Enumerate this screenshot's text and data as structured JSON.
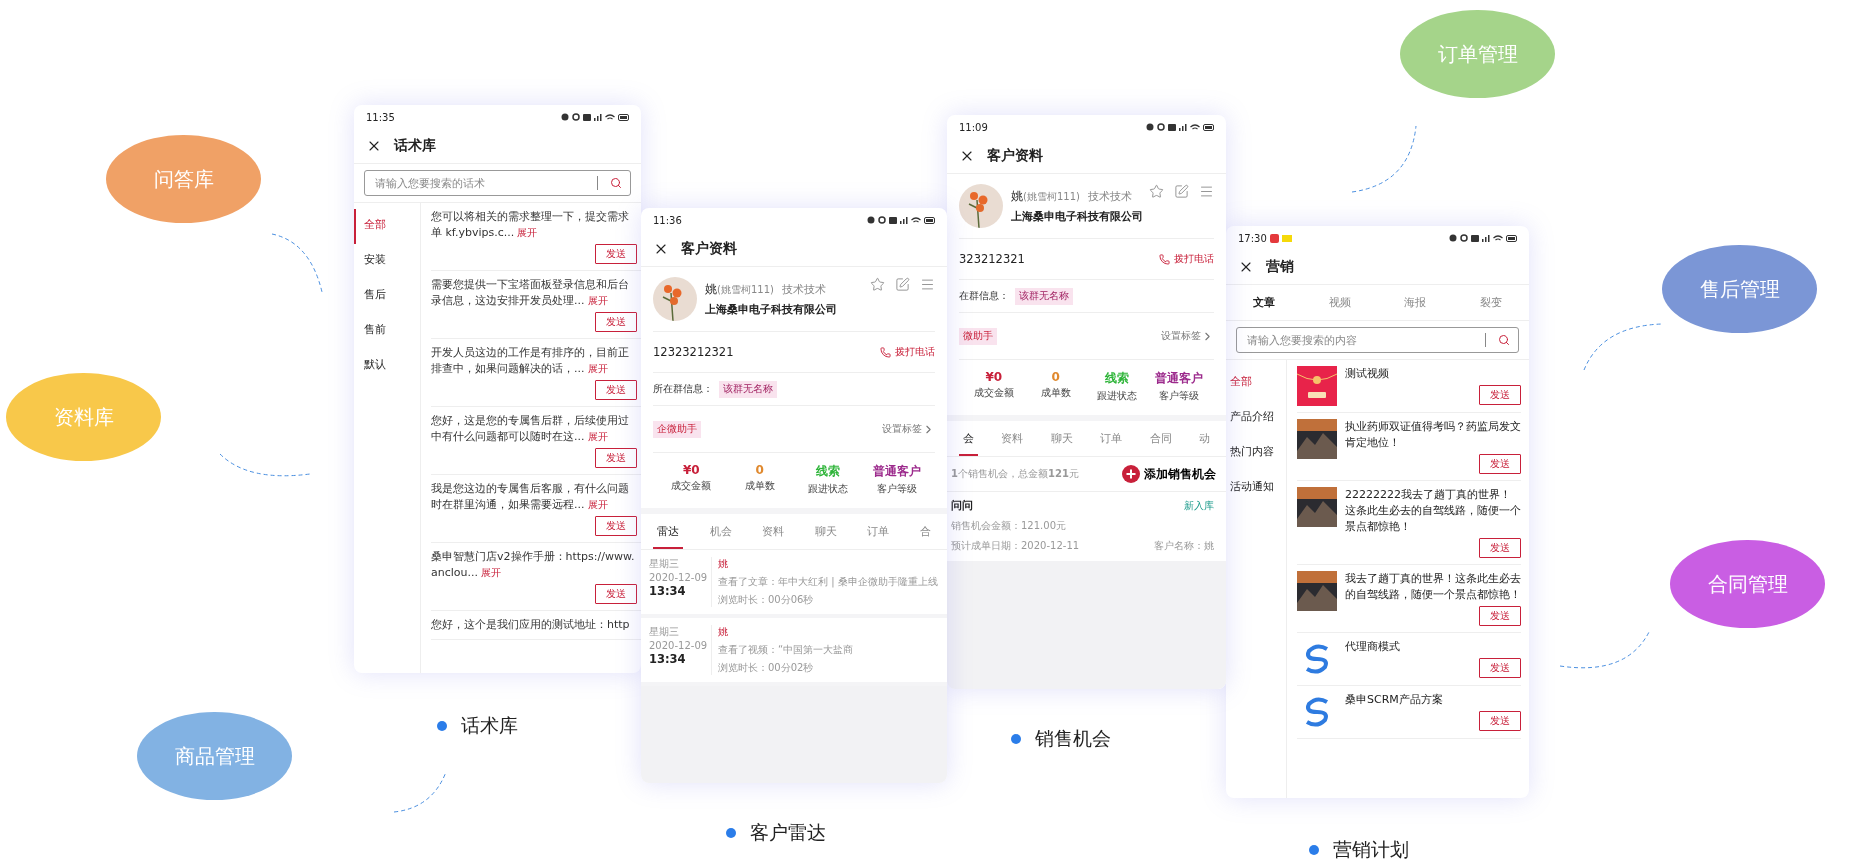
{
  "bubbles": [
    {
      "label": "问答库",
      "color": "#f0a166"
    },
    {
      "label": "资料库",
      "color": "#f8c84a"
    },
    {
      "label": "商品管理",
      "color": "#82b2e3"
    },
    {
      "label": "订单管理",
      "color": "#a5d48a"
    },
    {
      "label": "售后管理",
      "color": "#7b96d6"
    },
    {
      "label": "合同管理",
      "color": "#c95ee3"
    }
  ],
  "phones": [
    {
      "kind": "scripts",
      "time": "11:35",
      "title": "话术库",
      "search_placeholder": "请输入您要搜索的话术",
      "categories": [
        {
          "label": "全部",
          "selected": true
        },
        {
          "label": "安装",
          "selected": false
        },
        {
          "label": "售后",
          "selected": false
        },
        {
          "label": "售前",
          "selected": false
        },
        {
          "label": "默认",
          "selected": false
        }
      ],
      "items": [
        {
          "lines": [
            "您可以将相关的需求整理一下，提交需求",
            "单 kf.ybvips.c..."
          ],
          "expand": "展开",
          "send": "发送"
        },
        {
          "lines": [
            "需要您提供一下宝塔面板登录信息和后台",
            "录信息，这边安排开发员处理..."
          ],
          "expand": "展开",
          "send": "发送"
        },
        {
          "lines": [
            "开发人员这边的工作是有排序的，目前正",
            "排查中，如果问题解决的话，..."
          ],
          "expand": "展开",
          "send": "发送"
        },
        {
          "lines": [
            "您好，这是您的专属售后群，后续使用过",
            "中有什么问题都可以随时在这..."
          ],
          "expand": "展开",
          "send": "发送"
        },
        {
          "lines": [
            "我是您这边的专属售后客服，有什么问题",
            "时在群里沟通，如果需要远程..."
          ],
          "expand": "展开",
          "send": "发送"
        },
        {
          "lines": [
            "桑申智慧门店v2操作手册：https://www.",
            "anclou..."
          ],
          "expand": "展开",
          "send": "发送"
        },
        {
          "lines": [
            "您好，这个是我们应用的测试地址：http"
          ]
        }
      ]
    },
    {
      "kind": "profile",
      "time": "11:36",
      "title": "客户资料",
      "name": "姚",
      "alias": "(姚雪柯111)",
      "position": "技术技术",
      "company": "上海桑申电子科技有限公司",
      "phone": "12323212321",
      "call": "拨打电话",
      "group_label": "所在群信息：",
      "group": "该群无名称",
      "tag": "企微助手",
      "set_tags": "设置标签",
      "stats": [
        {
          "value": "¥0",
          "label": "成交金额",
          "color": "#c8203a"
        },
        {
          "value": "0",
          "label": "成单数",
          "color": "#e0892e"
        },
        {
          "value": "线索",
          "label": "跟进状态",
          "color": "#2fb53a"
        },
        {
          "value": "普通客户",
          "label": "客户等级",
          "color": "#9c2a8c"
        }
      ],
      "tabs": [
        {
          "label": "雷达",
          "selected": true
        },
        {
          "label": "机会",
          "selected": false
        },
        {
          "label": "资料",
          "selected": false
        },
        {
          "label": "聊天",
          "selected": false
        },
        {
          "label": "订单",
          "selected": false
        },
        {
          "label": "合",
          "selected": false
        }
      ],
      "radar": [
        {
          "weekday": "星期三",
          "date": "2020-12-09",
          "time": "13:34",
          "who": "姚",
          "action": "查看了文章：年中大红利 | 桑申企微助手隆重上线",
          "duration": "浏览时长：00分06秒"
        },
        {
          "weekday": "星期三",
          "date": "2020-12-09",
          "time": "13:34",
          "who": "姚",
          "action": "查看了视频：“中国第一大盐商",
          "duration": "浏览时长：00分02秒"
        }
      ]
    },
    {
      "kind": "profile",
      "time": "11:09",
      "title": "客户资料",
      "name": "姚",
      "alias": "(姚雪柯111)",
      "position": "技术技术",
      "company": "上海桑申电子科技有限公司",
      "phone": "323212321",
      "call": "拨打电话",
      "group_label": "在群信息：",
      "group": "该群无名称",
      "tag": "微助手",
      "set_tags": "设置标签",
      "stats": [
        {
          "value": "¥0",
          "label": "成交金额",
          "color": "#c8203a"
        },
        {
          "value": "0",
          "label": "成单数",
          "color": "#e0892e"
        },
        {
          "value": "线索",
          "label": "跟进状态",
          "color": "#2fb53a"
        },
        {
          "value": "普通客户",
          "label": "客户等级",
          "color": "#9c2a8c"
        }
      ],
      "tabs": [
        {
          "label": "会",
          "selected": true
        },
        {
          "label": "资料",
          "selected": false
        },
        {
          "label": "聊天",
          "selected": false
        },
        {
          "label": "订单",
          "selected": false
        },
        {
          "label": "合同",
          "selected": false
        },
        {
          "label": "动",
          "selected": false
        }
      ],
      "opportunity": {
        "summary": "**1**个销售机会，总金额**121**元",
        "add": "添加销售机会",
        "name": "问问",
        "status": "新入库",
        "amount": "销售机会金额：121.00元",
        "date": "预计成单日期：2020-12-11",
        "customer": "客户名称：姚"
      }
    },
    {
      "kind": "marketing",
      "time": "17:30",
      "title": "营销",
      "search_placeholder": "请输入您要搜索的内容",
      "tabs": [
        {
          "label": "文章",
          "selected": true
        },
        {
          "label": "视频",
          "selected": false
        },
        {
          "label": "海报",
          "selected": false
        },
        {
          "label": "裂变",
          "selected": false
        }
      ],
      "categories": [
        {
          "label": "全部",
          "selected": true
        },
        {
          "label": "产品介绍",
          "selected": false
        },
        {
          "label": "热门内容",
          "selected": false
        },
        {
          "label": "活动通知",
          "selected": false
        }
      ],
      "items": [
        {
          "kind": "envelope",
          "title": "测试视频",
          "send": "发送"
        },
        {
          "kind": "photo",
          "title": "执业药师双证值得考吗？药监局发文肯定地位！",
          "send": "发送"
        },
        {
          "kind": "photo",
          "title": "22222222我去了趟丁真的世界！这条此生必去的自驾线路，随便一个景点都惊艳！",
          "send": "发送"
        },
        {
          "kind": "photo",
          "title": "我去了趟丁真的世界！这条此生必去的自驾线路，随便一个景点都惊艳！",
          "send": "发送"
        },
        {
          "kind": "logo",
          "title": "代理商模式",
          "send": "发送"
        },
        {
          "kind": "logo",
          "title": "桑申SCRM产品方案",
          "send": "发送"
        }
      ]
    }
  ],
  "captions": [
    "话术库",
    "客户雷达",
    "销售机会",
    "营销计划"
  ]
}
